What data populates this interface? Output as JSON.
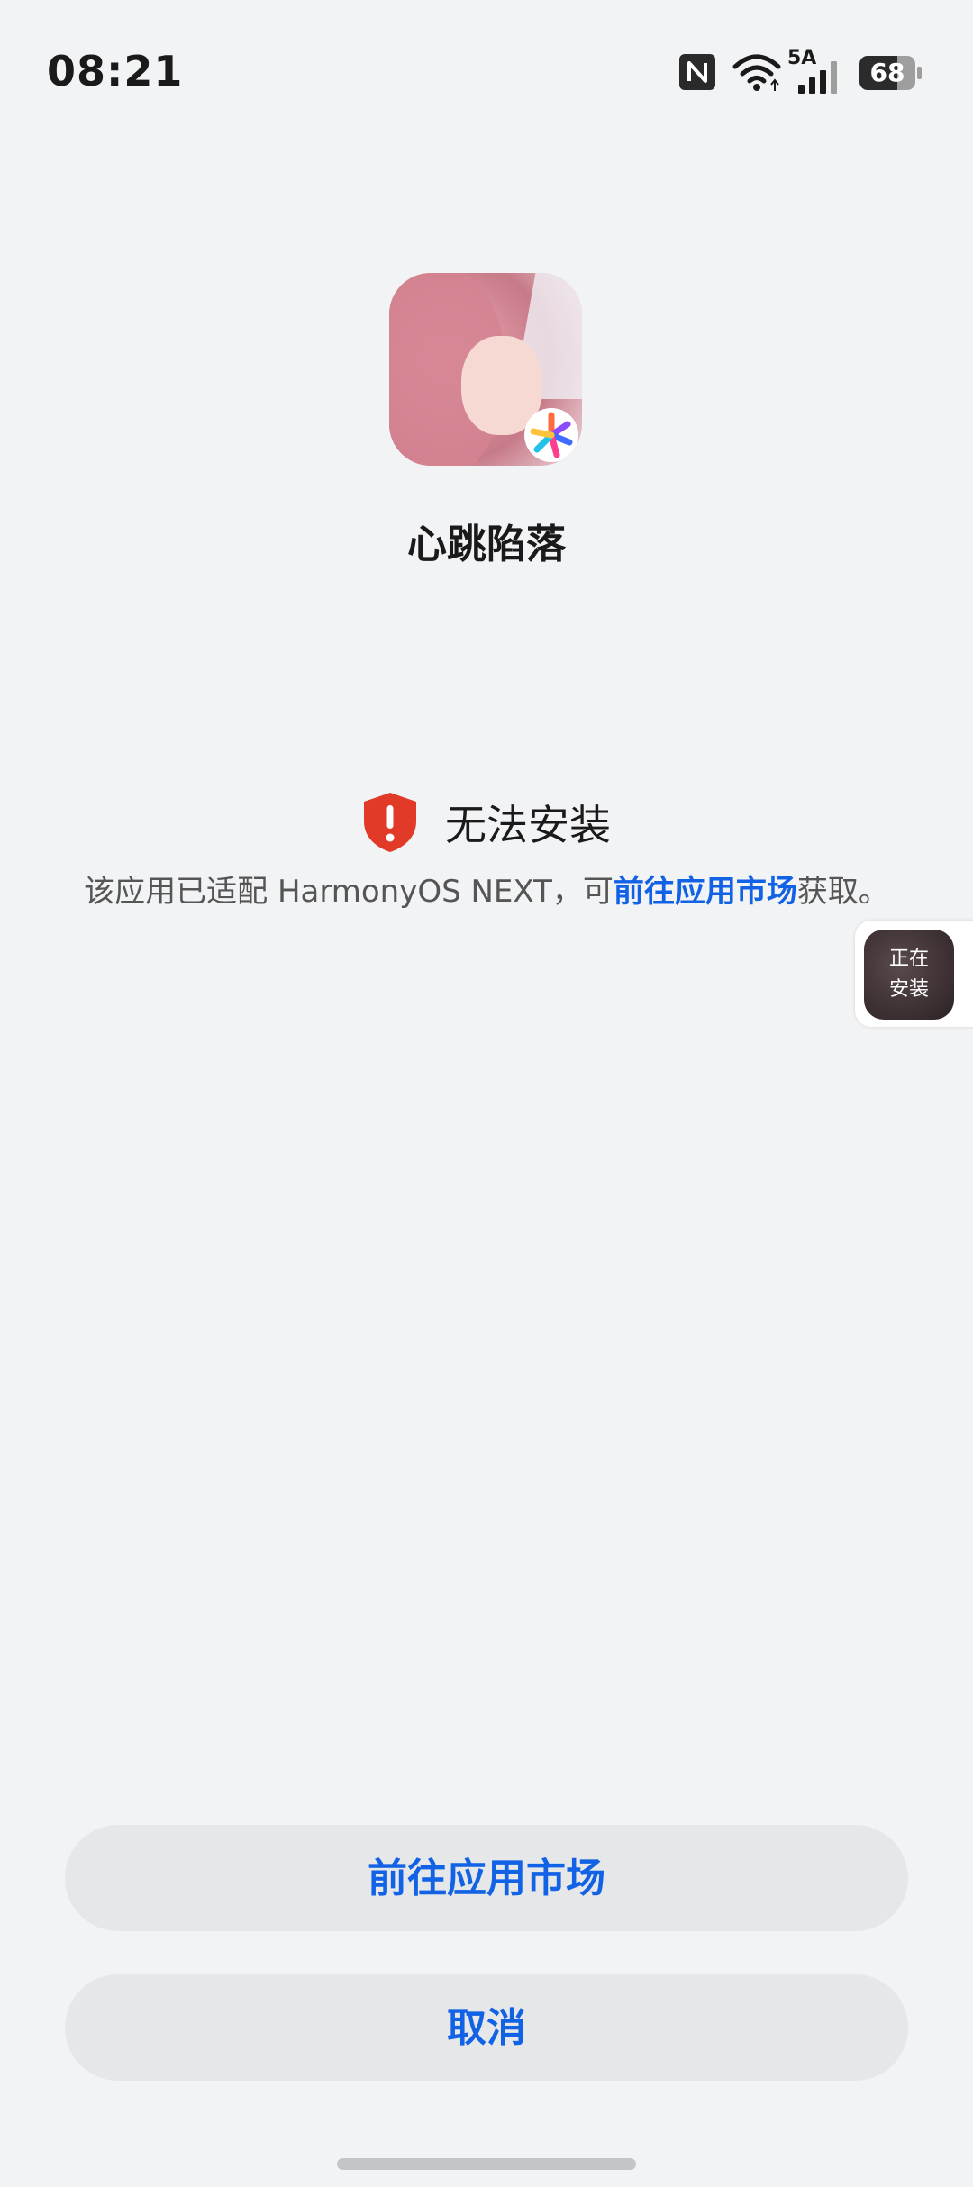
{
  "status_bar": {
    "time": "08:21",
    "network_type": "5A",
    "battery_level": "68",
    "icons": [
      "nfc-icon",
      "wifi-icon",
      "signal-icon",
      "battery-icon"
    ]
  },
  "app": {
    "name": "心跳陷落",
    "icon": "app-icon"
  },
  "install_status": {
    "icon": "shield-warning-icon",
    "title": "无法安装",
    "description_prefix": "该应用已适配 HarmonyOS NEXT，可",
    "description_link": "前往应用市场",
    "description_suffix": "获取。"
  },
  "installing_badge": {
    "label": "正在安装"
  },
  "actions": {
    "primary_label": "前往应用市场",
    "cancel_label": "取消"
  },
  "colors": {
    "background": "#f2f3f5",
    "accent": "#1262e6",
    "warning": "#e23a28",
    "button_bg": "#e6e7e9"
  }
}
